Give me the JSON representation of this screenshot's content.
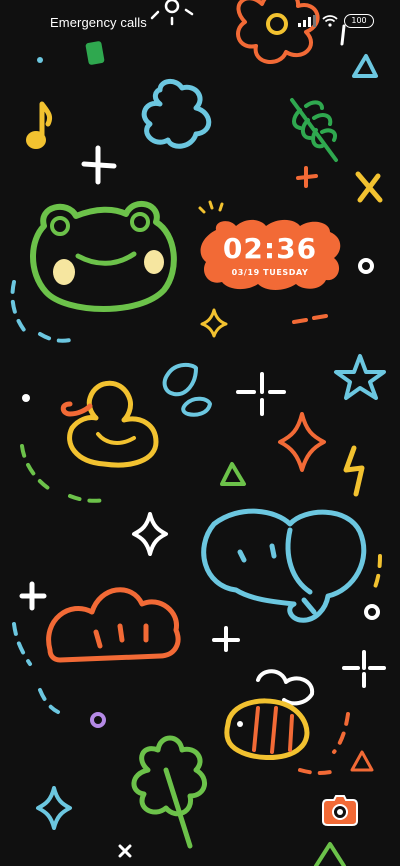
{
  "status_bar": {
    "carrier_text": "Emergency calls",
    "battery_level": "100",
    "signal": "signal-bars-icon",
    "wifi": "wifi-icon"
  },
  "lock_screen": {
    "time": "02:36",
    "date": "03/19 TUESDAY"
  },
  "shortcuts": {
    "camera": "camera-icon"
  },
  "colors": {
    "background": "#101010",
    "clock_badge": "#F26A36",
    "green": "#6CC24A",
    "orange": "#F26A36",
    "blue": "#6CC7E0",
    "yellow": "#F2C230",
    "white": "#FFFFFF"
  }
}
